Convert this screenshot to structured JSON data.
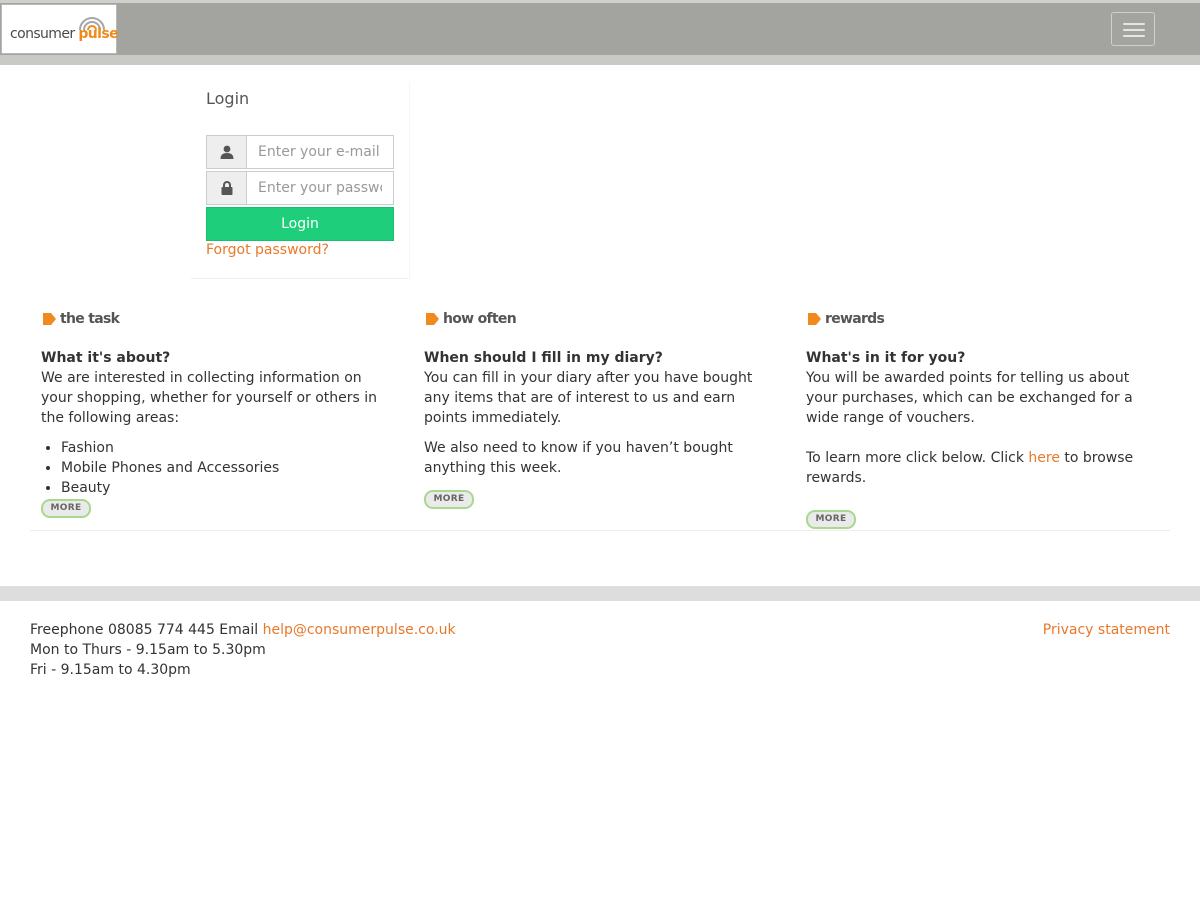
{
  "header": {
    "logo": {
      "word1": "consumer",
      "word2": "pulse"
    }
  },
  "login": {
    "title": "Login",
    "email_placeholder": "Enter your e-mail address",
    "password_placeholder": "Enter your password",
    "button_label": "Login",
    "forgot_label": "Forgot password?"
  },
  "columns": [
    {
      "heading": "the task",
      "question": "What it's about?",
      "text": "We are interested in collecting information on your shopping, whether for yourself or others in the following areas:",
      "list": [
        "Fashion",
        "Mobile Phones and Accessories",
        "Beauty"
      ],
      "more_label": "MORE"
    },
    {
      "heading": "how often",
      "question": "When should I fill in my diary?",
      "text": "You can fill in your diary after you have bought any items that are of interest to us and earn points immediately.",
      "text2": "We also need to know if you haven’t bought anything this week.",
      "more_label": "MORE"
    },
    {
      "heading": "rewards",
      "question": "What's in it for you?",
      "text": "You will be awarded points for telling us about your purchases, which can be exchanged for a wide range of vouchers.",
      "text2_before": "To learn more click below. Click ",
      "text2_link": "here",
      "text2_after": " to browse rewards.",
      "more_label": "MORE"
    }
  ],
  "footer": {
    "phone_text": "Freephone 08085 774 445 Email ",
    "email": "help@consumerpulse.co.uk",
    "hours1": "Mon to Thurs - 9.15am to 5.30pm",
    "hours2": "Fri - 9.15am to 4.30pm",
    "privacy_label": "Privacy statement"
  },
  "colors": {
    "navbar": "#a3a49f",
    "accent": "#e8782a",
    "login_button": "#1fce7a",
    "tag_icon": "#f08a1c"
  },
  "icons": {
    "user": "user-icon",
    "lock": "lock-icon",
    "menu": "hamburger-menu-icon",
    "tag": "tag-icon"
  }
}
